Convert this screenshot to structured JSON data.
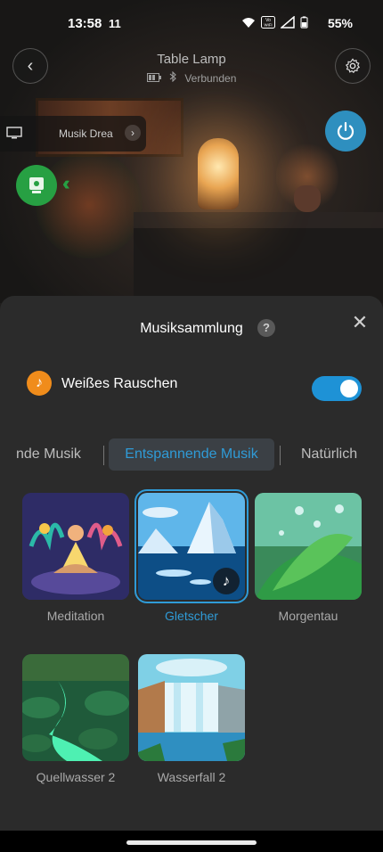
{
  "status_bar": {
    "time": "13:58",
    "notification": "11",
    "battery": "55%",
    "icons": [
      "wifi-icon",
      "vowifi-icon",
      "signal-icon",
      "battery-icon"
    ],
    "vowifi_text": "Vo WiFi"
  },
  "header": {
    "device_name": "Table Lamp",
    "connection_status": "Verbunden"
  },
  "music_chip": {
    "label": "Musik Drea"
  },
  "sheet": {
    "title": "Musiksammlung",
    "help": "?",
    "white_noise_label": "Weißes Rauschen",
    "white_noise_enabled": true,
    "tabs": [
      {
        "label": "nde Musik",
        "active": false
      },
      {
        "label": "Entspannende Musik",
        "active": true
      },
      {
        "label": "Natürlich",
        "active": false
      }
    ],
    "tracks": [
      {
        "label": "Meditation",
        "selected": false
      },
      {
        "label": "Gletscher",
        "selected": true
      },
      {
        "label": "Morgentau",
        "selected": false
      },
      {
        "label": "Quellwasser 2",
        "selected": false
      },
      {
        "label": "Wasserfall 2",
        "selected": false
      }
    ]
  },
  "colors": {
    "accent": "#2f9bd7",
    "power": "#2e8fbf",
    "green": "#27a043",
    "note": "#f08c1b",
    "sheet_bg": "#2b2b2b"
  }
}
